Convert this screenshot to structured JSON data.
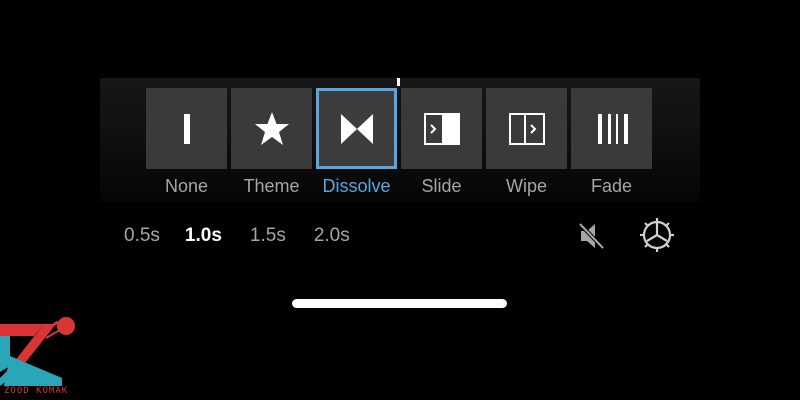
{
  "transitions": [
    {
      "label": "None",
      "icon": "none-transition-icon",
      "selected": false
    },
    {
      "label": "Theme",
      "icon": "star-icon",
      "selected": false
    },
    {
      "label": "Dissolve",
      "icon": "dissolve-icon",
      "selected": true
    },
    {
      "label": "Slide",
      "icon": "slide-icon",
      "selected": false
    },
    {
      "label": "Wipe",
      "icon": "wipe-icon",
      "selected": false
    },
    {
      "label": "Fade",
      "icon": "fade-icon",
      "selected": false
    }
  ],
  "durations": [
    {
      "label": "0.5s",
      "active": false
    },
    {
      "label": "1.0s",
      "active": true
    },
    {
      "label": "1.5s",
      "active": false
    },
    {
      "label": "2.0s",
      "active": false
    }
  ],
  "controls": {
    "mute_icon": "speaker-muted-icon",
    "settings_icon": "gear-icon"
  },
  "watermark": {
    "text": "ZOOD KOMAK"
  },
  "colors": {
    "accent": "#5aa6e0",
    "tile": "#3a3a3a",
    "label": "#a6a6a6",
    "brand_red": "#d93535",
    "brand_teal": "#2aa6b8"
  }
}
